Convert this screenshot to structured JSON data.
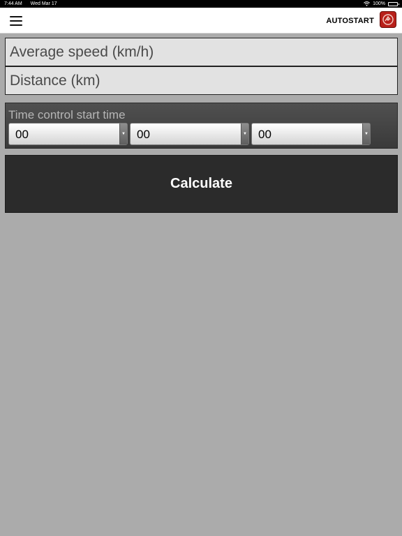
{
  "status_bar": {
    "time": "7:44 AM",
    "date": "Wed Mar 17",
    "battery": "100%",
    "wifi_icon": "wifi-icon",
    "battery_icon": "battery-icon"
  },
  "nav": {
    "menu_icon": "hamburger-menu-icon",
    "brand": "AUTOSTART",
    "logo_icon": "autostart-logo-icon",
    "brand_color": "#b8201a"
  },
  "form": {
    "average_speed": {
      "placeholder": "Average speed (km/h)",
      "value": ""
    },
    "distance": {
      "placeholder": "Distance (km)",
      "value": ""
    },
    "time_control": {
      "label": "Time control start time",
      "hours": {
        "value": "00"
      },
      "minutes": {
        "value": "00"
      },
      "seconds": {
        "value": "00"
      },
      "arrow_icon": "dropdown-arrow-icon"
    },
    "calculate_label": "Calculate"
  },
  "colors": {
    "background": "#ababab",
    "field_bg": "#e2e2e2",
    "button_bg": "#2b2b2b"
  }
}
